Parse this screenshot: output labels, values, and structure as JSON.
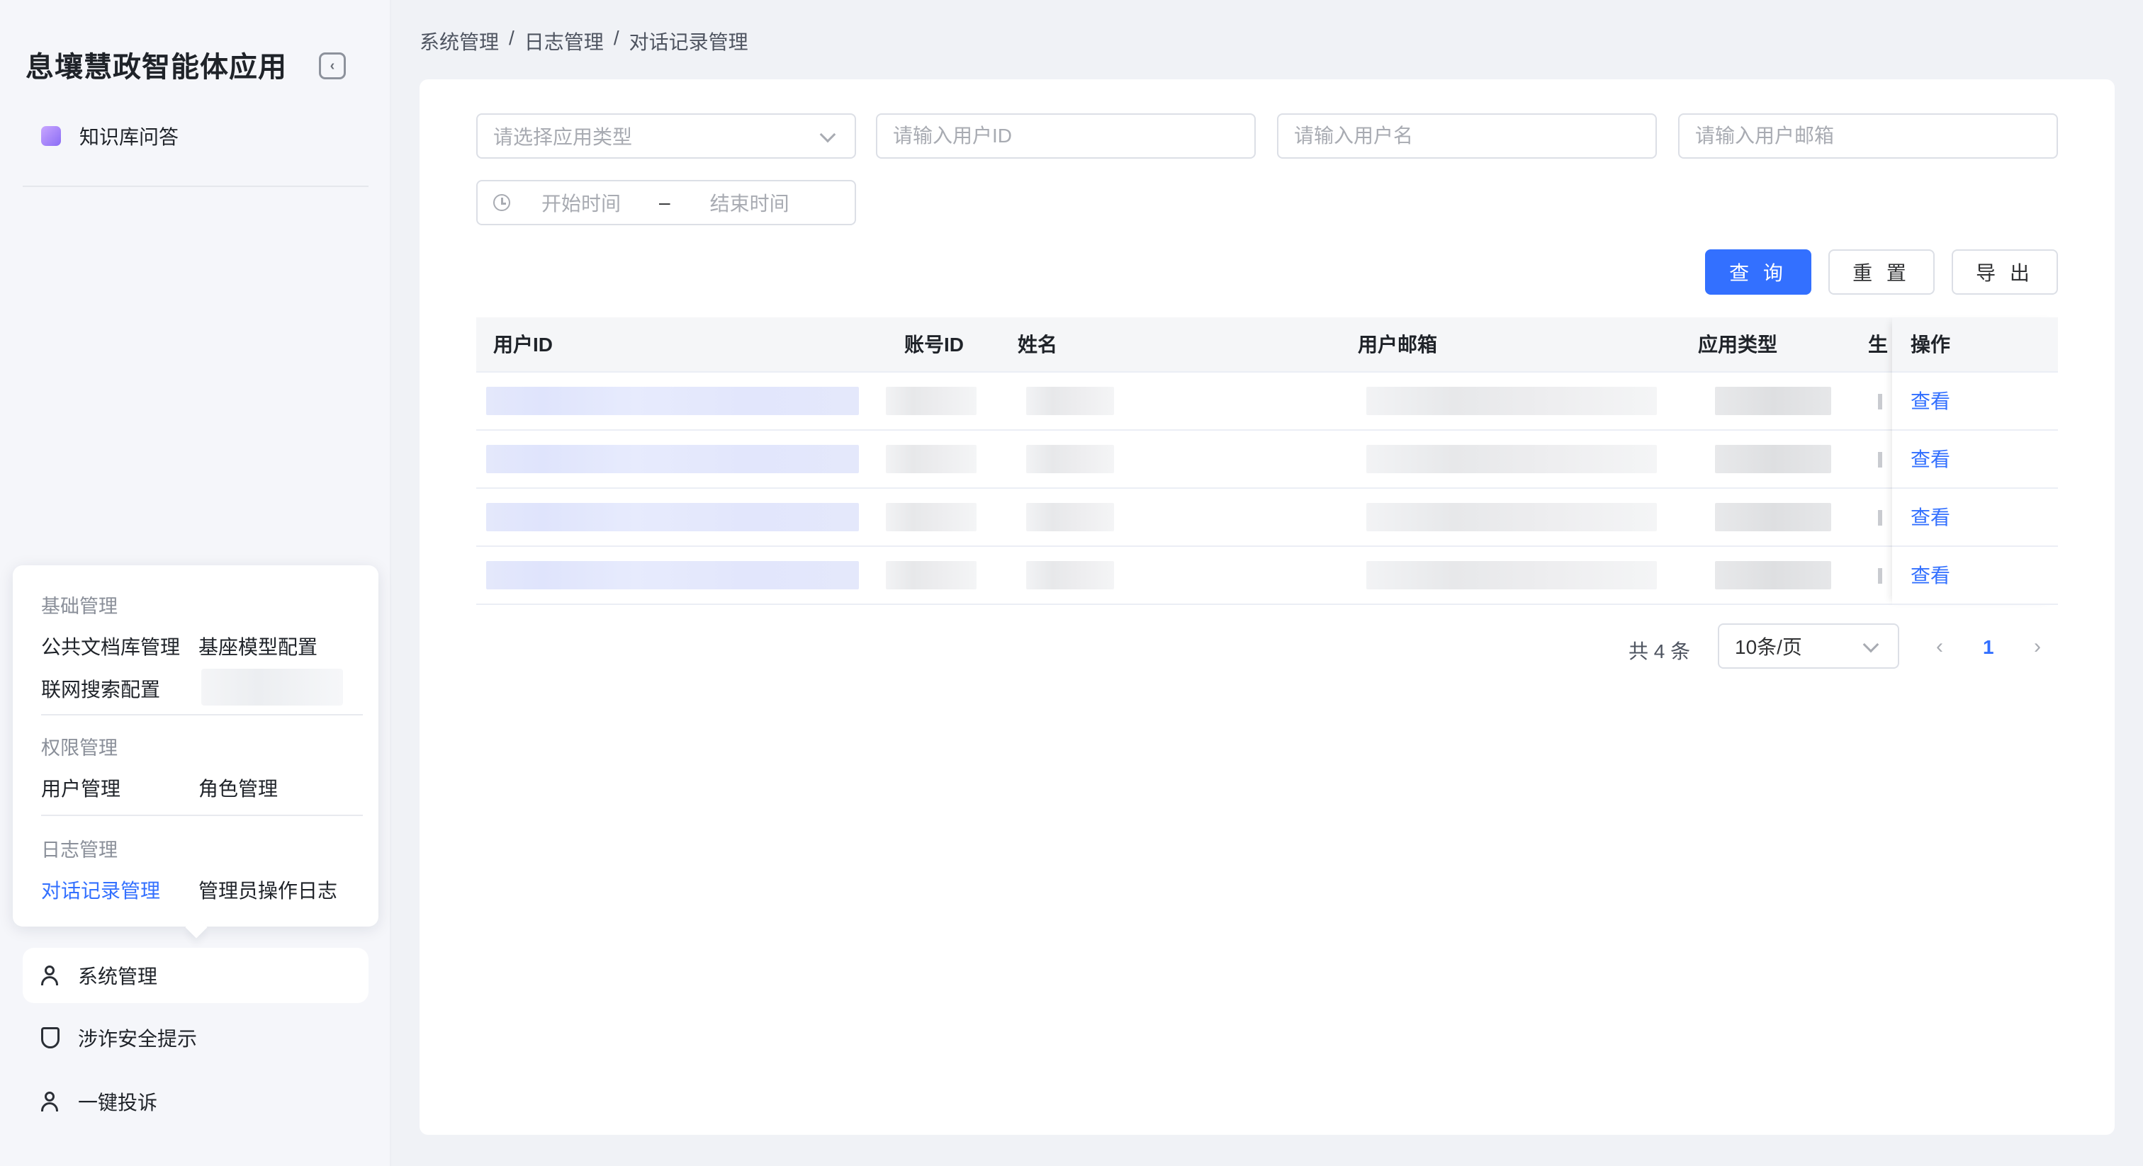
{
  "app": {
    "title": "息壤慧政智能体应用"
  },
  "sidebar": {
    "top_item": {
      "label": "知识库问答",
      "icon": "knowledge-base-icon"
    },
    "menu": {
      "groups": [
        {
          "title": "基础管理",
          "items": [
            "公共文档库管理",
            "基座模型配置",
            "联网搜索配置"
          ]
        },
        {
          "title": "权限管理",
          "items": [
            "用户管理",
            "角色管理"
          ]
        },
        {
          "title": "日志管理",
          "items": [
            "对话记录管理",
            "管理员操作日志"
          ]
        }
      ],
      "active_item": "对话记录管理"
    },
    "bottom_items": [
      {
        "label": "系统管理",
        "icon": "user-settings-icon"
      },
      {
        "label": "涉诈安全提示",
        "icon": "shield-icon"
      },
      {
        "label": "一键投诉",
        "icon": "complaint-icon"
      }
    ]
  },
  "breadcrumb": [
    "系统管理",
    "日志管理",
    "对话记录管理"
  ],
  "filters": {
    "app_type_placeholder": "请选择应用类型",
    "user_id_placeholder": "请输入用户ID",
    "username_placeholder": "请输入用户名",
    "email_placeholder": "请输入用户邮箱",
    "start_time_placeholder": "开始时间",
    "range_separator": "–",
    "end_time_placeholder": "结束时间"
  },
  "actions": {
    "query": "查 询",
    "reset": "重 置",
    "export": "导 出"
  },
  "table": {
    "columns": [
      "用户ID",
      "账号ID",
      "姓名",
      "用户邮箱",
      "应用类型",
      "生",
      "操作"
    ],
    "row_action": "查看",
    "row_count": 4
  },
  "pagination": {
    "total_text": "共 4 条",
    "page_size": "10条/页",
    "current_page": "1"
  },
  "colors": {
    "primary": "#3370ff",
    "sidebar_bg": "#f5f6fa",
    "page_bg": "#f0f2f6"
  }
}
